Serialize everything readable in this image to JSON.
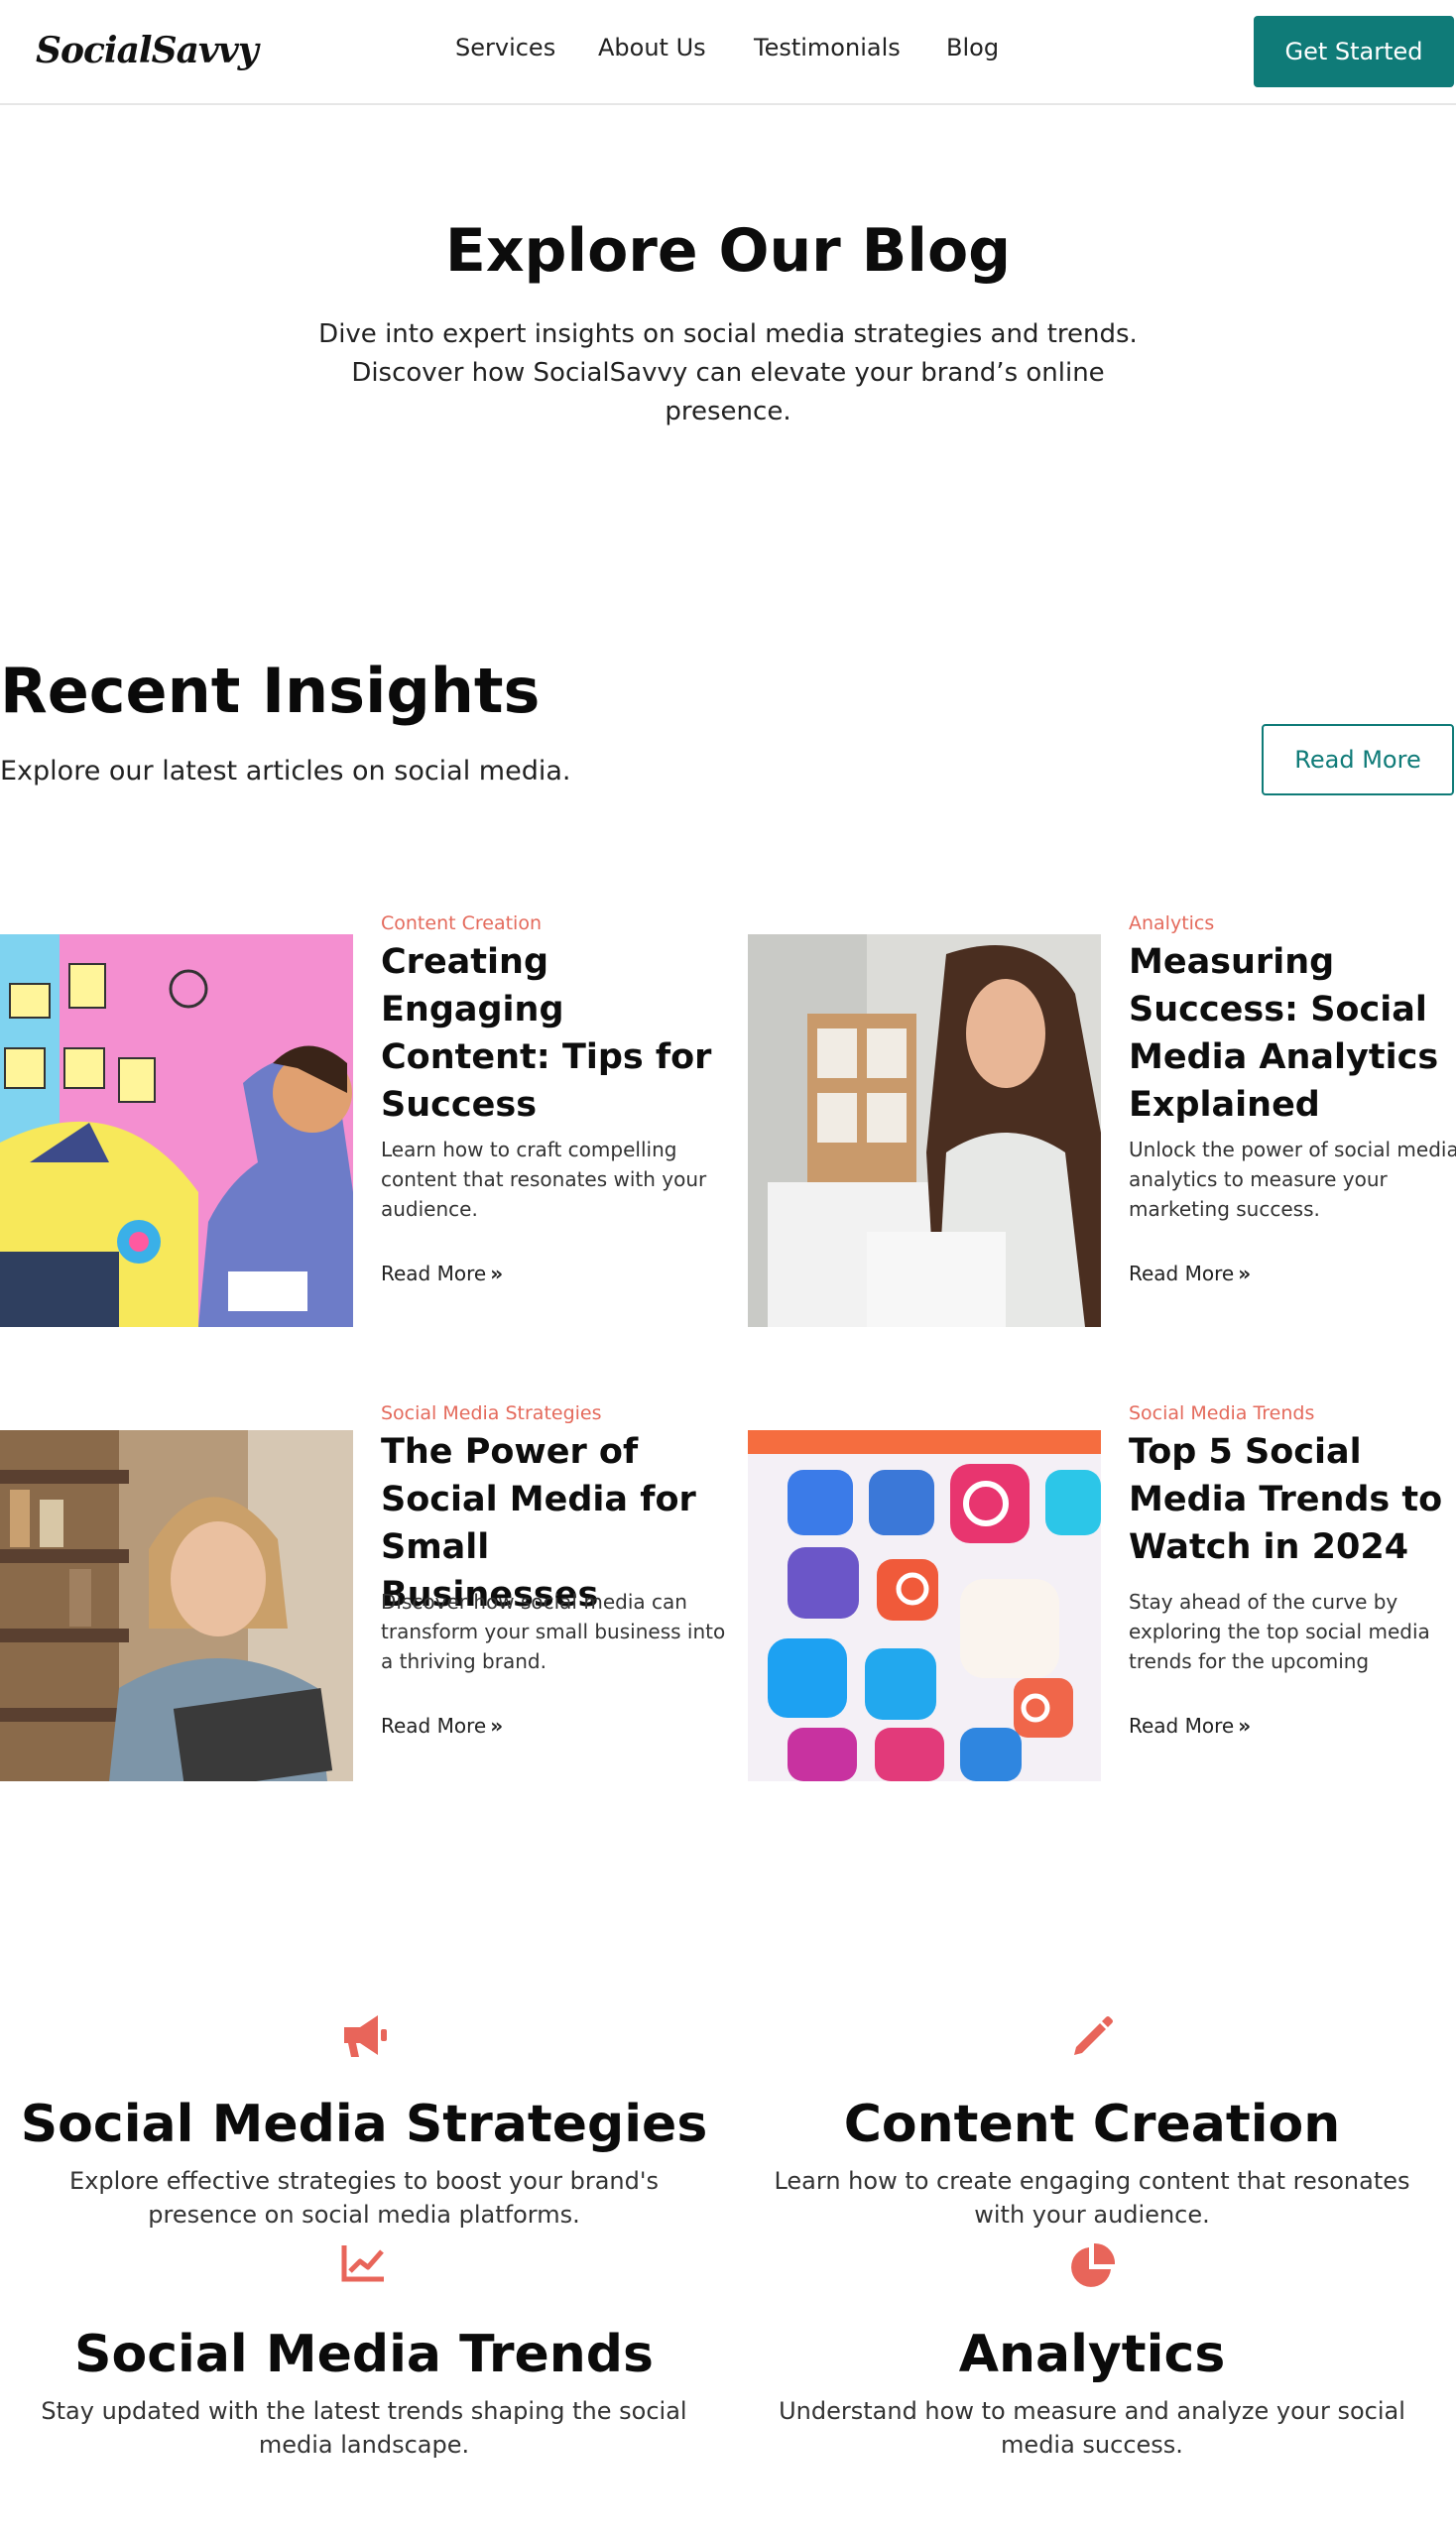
{
  "header": {
    "logo": "SocialSavvy",
    "nav": [
      "Services",
      "About Us",
      "Testimonials",
      "Blog"
    ],
    "cta": "Get Started"
  },
  "hero": {
    "title": "Explore Our Blog",
    "subtitle": "Dive into expert insights on social media strategies and trends. Discover how SocialSavvy can elevate your brand’s online presence."
  },
  "recent": {
    "title": "Recent Insights",
    "subtitle": "Explore our latest articles on social media.",
    "button": "Read More"
  },
  "posts": [
    {
      "category": "Content Creation",
      "title": "Creating Engaging Content: Tips for Success",
      "description": "Learn how to craft compelling content that resonates with your audience.",
      "link": "Read More",
      "image": "illustration of man sketching content ideas"
    },
    {
      "category": "Analytics",
      "title": "Measuring Success: Social Media Analytics Explained",
      "description": "Unlock the power of social media analytics to measure your marketing success.",
      "link": "Read More",
      "image": "woman working on laptop"
    },
    {
      "category": "Social Media Strategies",
      "title": "The Power of Social Media for Small Businesses",
      "description": "Discover how social media can transform your small business into a thriving brand.",
      "link": "Read More",
      "image": "smiling shop owner holding tablet"
    },
    {
      "category": "Social Media Trends",
      "title": "Top 5 Social Media Trends to Watch in 2024",
      "description": "Stay ahead of the curve by exploring the top social media trends for the upcoming",
      "link": "Read More",
      "image": "pile of social media app icons"
    }
  ],
  "features": [
    {
      "icon": "megaphone-icon",
      "title": "Social Media Strategies",
      "description": "Explore effective strategies to boost your brand's presence on social media platforms."
    },
    {
      "icon": "pencil-icon",
      "title": "Content Creation",
      "description": "Learn how to create engaging content that resonates with your audience."
    },
    {
      "icon": "chart-line-icon",
      "title": "Social Media Trends",
      "description": "Stay updated with the latest trends shaping the social media landscape."
    },
    {
      "icon": "pie-chart-icon",
      "title": "Analytics",
      "description": "Understand how to measure and analyze your social media success."
    }
  ],
  "colors": {
    "brand": "#0f7b78",
    "accent": "#e46a5c"
  }
}
